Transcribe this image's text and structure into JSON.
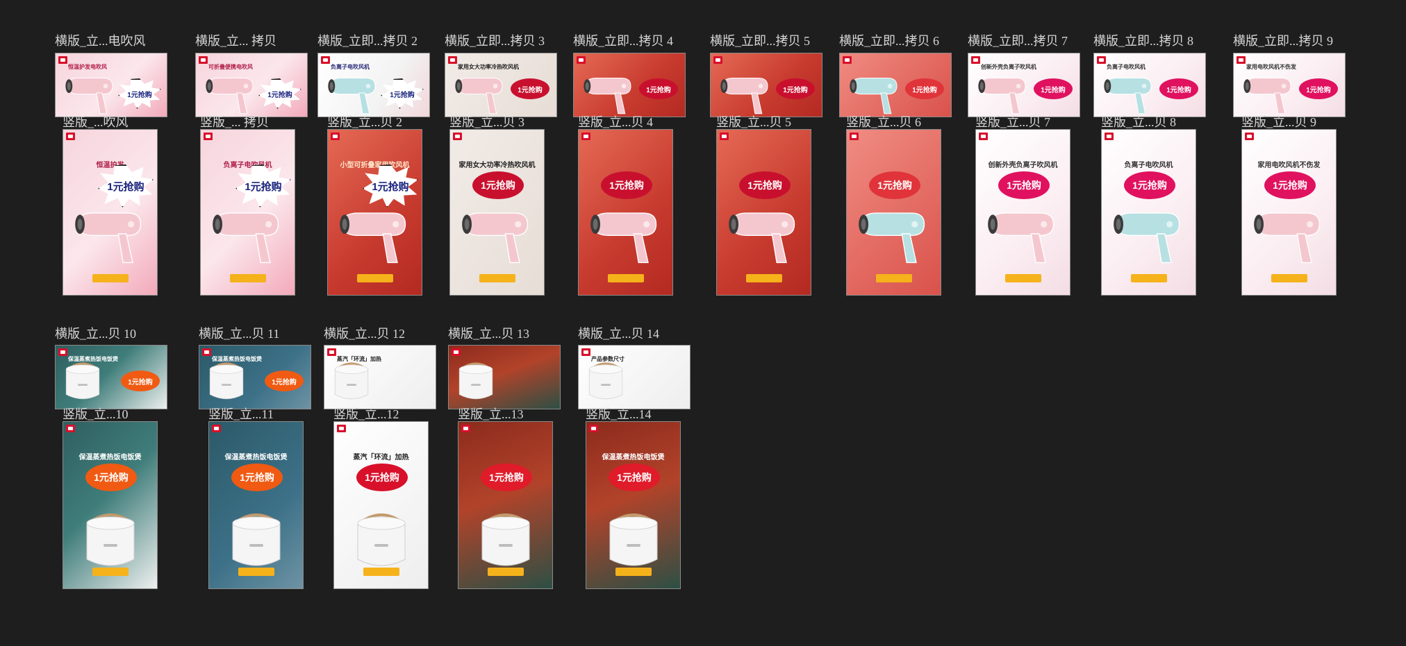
{
  "colors": {
    "background": "#1e1e1e",
    "label": "#d6d6d6",
    "frame_border": "#8a8a8a",
    "brand_red": "#d8102a",
    "promo_yellow": "#f5b21a"
  },
  "row1": [
    {
      "name": "横版_立...电吹风",
      "subtitle": "恒温护发电吹风",
      "badge": "1元抢购",
      "product": "dryer",
      "theme": "pink"
    },
    {
      "name": "横版_立... 拷贝",
      "subtitle": "可折叠便携电吹风",
      "badge": "1元抢购",
      "product": "dryer",
      "theme": "pink"
    },
    {
      "name": "横版_立即...拷贝 2",
      "subtitle": "负离子电吹风机",
      "badge": "1元抢购",
      "product": "dryer",
      "theme": "white-red"
    },
    {
      "name": "横版_立即...拷贝 3",
      "subtitle": "家用女大功率冷热吹风机",
      "badge": "1元抢购",
      "product": "dryer",
      "theme": "gray"
    },
    {
      "name": "横版_立即...拷贝 4",
      "subtitle": "",
      "badge": "1元抢购",
      "product": "dryer",
      "theme": "red"
    },
    {
      "name": "横版_立即...拷贝 5",
      "subtitle": "",
      "badge": "1元抢购",
      "product": "dryer",
      "theme": "red"
    },
    {
      "name": "横版_立即...拷贝 6",
      "subtitle": "",
      "badge": "1元抢购",
      "product": "dryer",
      "theme": "red-pink"
    },
    {
      "name": "横版_立即...拷贝 7",
      "subtitle": "创新外壳负离子吹风机",
      "badge": "1元抢购",
      "product": "dryer",
      "theme": "light"
    },
    {
      "name": "横版_立即...拷贝 8",
      "subtitle": "负离子电吹风机",
      "badge": "1元抢购",
      "product": "dryer",
      "theme": "light"
    },
    {
      "name": "横版_立即...拷贝 9",
      "subtitle": "家用电吹风机不伤发",
      "badge": "1元抢购",
      "product": "dryer",
      "theme": "light"
    }
  ],
  "row2": [
    {
      "name": "竖版_...吹风",
      "subtitle": "恒温护发",
      "badge": "1元抢购",
      "product": "dryer",
      "theme": "pink"
    },
    {
      "name": "竖版_... 拷贝",
      "subtitle": "负离子电吹风机",
      "badge": "1元抢购",
      "product": "dryer",
      "theme": "pink"
    },
    {
      "name": "竖版_立...贝 2",
      "subtitle": "小型可折叠家用吹风机",
      "badge": "1元抢购",
      "product": "dryer",
      "theme": "red"
    },
    {
      "name": "竖版_立...贝 3",
      "subtitle": "家用女大功率冷热吹风机",
      "badge": "1元抢购",
      "product": "dryer",
      "theme": "gray"
    },
    {
      "name": "竖版_立...贝 4",
      "subtitle": "",
      "badge": "1元抢购",
      "product": "dryer",
      "theme": "red"
    },
    {
      "name": "竖版_立...贝 5",
      "subtitle": "",
      "badge": "1元抢购",
      "product": "dryer",
      "theme": "red"
    },
    {
      "name": "竖版_立...贝 6",
      "subtitle": "",
      "badge": "1元抢购",
      "product": "dryer",
      "theme": "red-pink"
    },
    {
      "name": "竖版_立...贝 7",
      "subtitle": "创新外壳负离子吹风机",
      "badge": "1元抢购",
      "product": "dryer",
      "theme": "light"
    },
    {
      "name": "竖版_立...贝 8",
      "subtitle": "负离子电吹风机",
      "badge": "1元抢购",
      "product": "dryer",
      "theme": "light"
    },
    {
      "name": "竖版_立...贝 9",
      "subtitle": "家用电吹风机不伤发",
      "badge": "1元抢购",
      "product": "dryer",
      "theme": "light"
    }
  ],
  "row3": [
    {
      "name": "横版_立...贝 10",
      "subtitle": "保温蒸煮热饭电饭煲",
      "badge": "1元抢购",
      "product": "cooker",
      "theme": "teal"
    },
    {
      "name": "横版_立...贝 11",
      "subtitle": "保温蒸煮热饭电饭煲",
      "badge": "1元抢购",
      "product": "cooker",
      "theme": "teal-dark"
    },
    {
      "name": "横版_立...贝 12",
      "subtitle": "蒸汽「环流」加热",
      "badge": "",
      "product": "cooker",
      "theme": "white"
    },
    {
      "name": "横版_立...贝 13",
      "subtitle": "",
      "badge": "",
      "product": "cooker",
      "theme": "dark-red"
    },
    {
      "name": "横版_立...贝 14",
      "subtitle": "产品参数尺寸",
      "badge": "",
      "product": "cooker",
      "theme": "white"
    }
  ],
  "row4": [
    {
      "name": "竖版_立...10",
      "subtitle": "保温蒸煮热饭电饭煲",
      "badge": "1元抢购",
      "product": "cooker",
      "theme": "teal"
    },
    {
      "name": "竖版_立...11",
      "subtitle": "保温蒸煮热饭电饭煲",
      "badge": "1元抢购",
      "product": "cooker",
      "theme": "teal-dark"
    },
    {
      "name": "竖版_立...12",
      "subtitle": "蒸汽「环流」加热",
      "badge": "1元抢购",
      "product": "cooker",
      "theme": "white"
    },
    {
      "name": "竖版_立...13",
      "subtitle": "",
      "badge": "1元抢购",
      "product": "cooker",
      "theme": "dark-red"
    },
    {
      "name": "竖版_立...14",
      "subtitle": "保温蒸煮热饭电饭煲",
      "badge": "1元抢购",
      "product": "cooker",
      "theme": "dark-red"
    }
  ]
}
